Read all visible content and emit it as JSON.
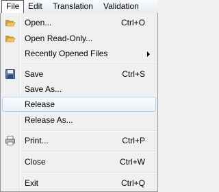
{
  "menubar": {
    "items": [
      {
        "label": "File"
      },
      {
        "label": "Edit"
      },
      {
        "label": "Translation"
      },
      {
        "label": "Validation"
      }
    ]
  },
  "file_menu": {
    "open": {
      "label": "Open...",
      "shortcut": "Ctrl+O",
      "icon": "folder-icon"
    },
    "open_readonly": {
      "label": "Open Read-Only...",
      "icon": "folder-icon"
    },
    "recent": {
      "label": "Recently Opened Files",
      "submenu": true
    },
    "save": {
      "label": "Save",
      "shortcut": "Ctrl+S",
      "icon": "floppy-disk-icon"
    },
    "save_as": {
      "label": "Save As..."
    },
    "release": {
      "label": "Release",
      "highlighted": true
    },
    "release_as": {
      "label": "Release As..."
    },
    "print": {
      "label": "Print...",
      "shortcut": "Ctrl+P",
      "icon": "printer-icon"
    },
    "close": {
      "label": "Close",
      "shortcut": "Ctrl+W"
    },
    "exit": {
      "label": "Exit",
      "shortcut": "Ctrl+Q"
    }
  },
  "colors": {
    "highlight_border": "#aecff7",
    "menu_background": "#f0f0f0"
  }
}
